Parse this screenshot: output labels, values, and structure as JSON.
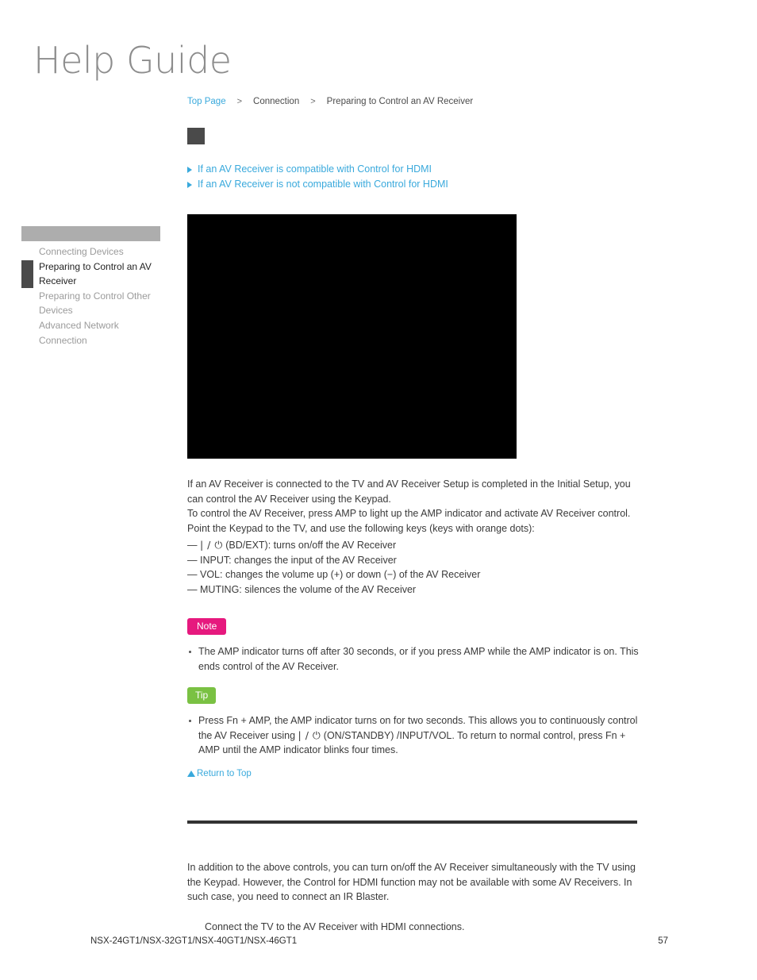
{
  "masthead": {
    "title": "Help Guide"
  },
  "breadcrumb": {
    "top_page": "Top Page",
    "separator": ">",
    "section": "Connection",
    "current": "Preparing to Control an AV Receiver"
  },
  "anchor_links": [
    {
      "label": "If an AV Receiver is compatible with Control for HDMI",
      "icon": "triangle-right-icon"
    },
    {
      "label": "If an AV Receiver is not compatible with Control for HDMI",
      "icon": "triangle-right-icon"
    }
  ],
  "sidebar": {
    "items": [
      {
        "label": "Connecting Devices",
        "active": false
      },
      {
        "label": "Preparing to Control an AV Receiver",
        "active": true
      },
      {
        "label": "Preparing to Control Other Devices",
        "active": false
      },
      {
        "label": "Advanced Network Connection",
        "active": false
      }
    ]
  },
  "main": {
    "intro_paragraph_1": "If an AV Receiver is connected to the TV and AV Receiver Setup is completed in the Initial Setup, you can control the AV Receiver using the Keypad.",
    "intro_paragraph_2": "To control the AV Receiver, press AMP to light up the AMP indicator and activate AV Receiver control. Point the Keypad to the TV, and use the following keys (keys with orange dots):",
    "key_list": [
      {
        "dash": "—",
        "symbol": "| / ⏻",
        "text": " (BD/EXT): turns on/off the AV Receiver"
      },
      {
        "dash": "—",
        "symbol": "",
        "text": "INPUT: changes the input of the AV Receiver"
      },
      {
        "dash": "—",
        "symbol": "",
        "text": "VOL: changes the volume up (+) or down (−) of the AV Receiver"
      },
      {
        "dash": "—",
        "symbol": "",
        "text": "MUTING: silences the volume of the AV Receiver"
      }
    ]
  },
  "note": {
    "badge": "Note",
    "badge_color": "#e6197e",
    "text": "The AMP indicator turns off after 30 seconds, or if you press AMP while the AMP indicator is on. This ends control of the AV Receiver."
  },
  "tip": {
    "badge": "Tip",
    "badge_color": "#7ac143",
    "text_part_1": "Press Fn + AMP, the AMP indicator turns on for two seconds. This allows you to continuously control the AV Receiver using",
    "symbol": "| / ⏻",
    "text_part_2": "(ON/STANDBY) /INPUT/VOL. To return to normal control, press Fn + AMP until the AMP indicator blinks four times."
  },
  "return_to_top": {
    "label": "Return to Top",
    "icon": "triangle-up-icon"
  },
  "lower": {
    "paragraph": "In addition to the above controls, you can turn on/off the AV Receiver simultaneously with the TV using the Keypad. However, the Control for HDMI function may not be available with some AV Receivers. In such case, you need to connect an IR Blaster.",
    "step_caption": "Connect the TV to the AV Receiver with HDMI connections."
  },
  "footer": {
    "models": "NSX-24GT1/NSX-32GT1/NSX-40GT1/NSX-46GT1",
    "page_number": "57"
  },
  "colors": {
    "link_blue": "#39a9dc",
    "sidebar_bar_gray": "#adadad",
    "active_marker_gray": "#4a4a4a",
    "divider_dark": "#333333",
    "figure_black": "#000000"
  }
}
